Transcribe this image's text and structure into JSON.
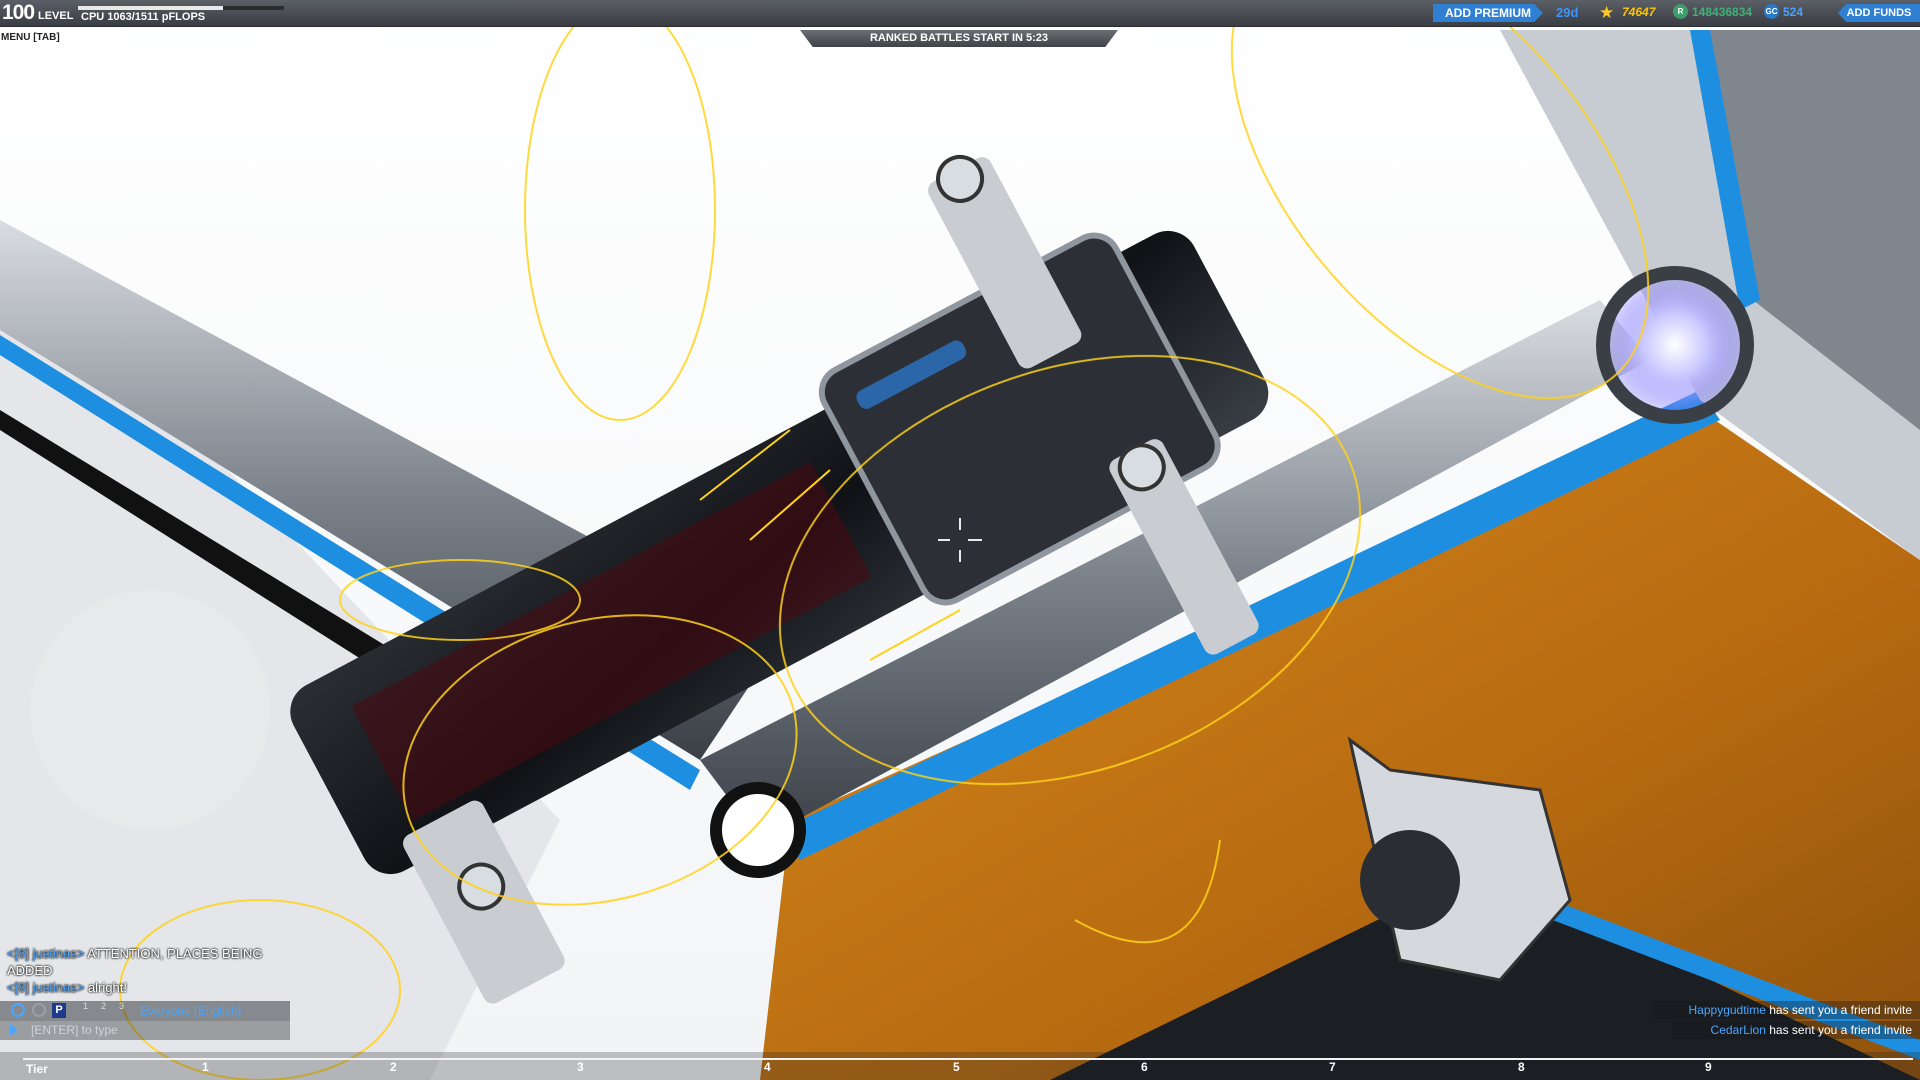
{
  "hud": {
    "level_value": "100",
    "level_label": "LEVEL",
    "cpu_text": "CPU 1063/1511 pFLOPS",
    "cpu_fraction": 0.703,
    "menu_hint": "MENU [TAB]",
    "ranked_banner": "RANKED BATTLES START IN 5:23"
  },
  "currency": {
    "premium_button": "ADD PREMIUM",
    "premium_days": "29d",
    "star_value": "74647",
    "robits_value": "148436834",
    "galaxy_value": "524",
    "funds_button": "ADD FUNDS",
    "icons": {
      "star": "star-icon",
      "robits": "robits-icon",
      "galaxy": "galaxy-coin-icon"
    },
    "accent": "#2f7fd3"
  },
  "chat": {
    "lines": [
      {
        "user": "<[8] justinas>",
        "text": " ATTENTION, PLACES BEING"
      },
      {
        "user": "",
        "text": "ADDED"
      },
      {
        "user": "<[8] justinas>",
        "text": " alright!"
      }
    ],
    "channel_numbers": [
      "1",
      "2",
      "3"
    ],
    "channel_party": "P",
    "channel_label": "Everyone (English)",
    "input_placeholder": "[ENTER] to type"
  },
  "notifications": [
    {
      "name": "Happygudtime",
      "text": " has sent you a friend invite"
    },
    {
      "name": "CedarLion",
      "text": " has sent you a friend invite"
    }
  ],
  "tier": {
    "label": "Tier",
    "ticks": [
      "1",
      "2",
      "3",
      "4",
      "5",
      "6",
      "7",
      "8",
      "9"
    ]
  }
}
